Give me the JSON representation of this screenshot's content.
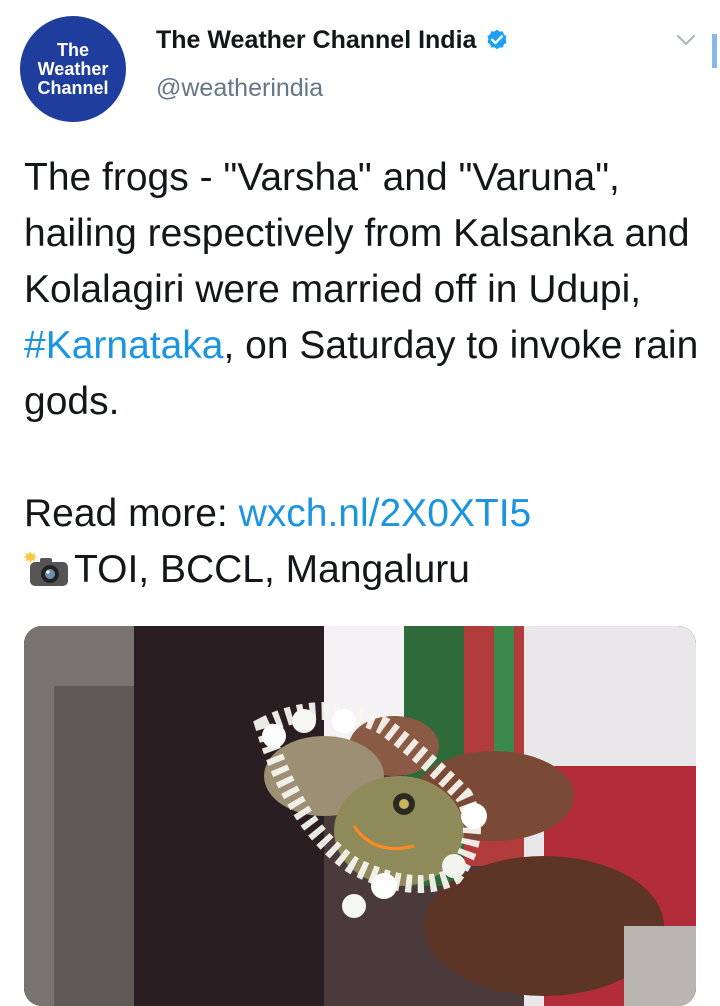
{
  "avatar": {
    "line1": "The",
    "line2": "Weather",
    "line3": "Channel"
  },
  "author": {
    "name": "The Weather Channel India",
    "handle": "@weatherindia"
  },
  "tweet": {
    "text_before": "The frogs - \"Varsha\" and \"Varuna\", hailing respectively from Kalsanka and Kolalagiri were married off in Udupi, ",
    "hashtag": "#Karnataka",
    "text_after": ", on Saturday to invoke rain gods.",
    "read_more_label": "Read more: ",
    "read_more_link": "wxch.nl/2X0XTI5",
    "credit": "TOI, BCCL, Mangaluru"
  },
  "icons": {
    "verified": "verified-badge-icon",
    "menu": "chevron-down-icon",
    "camera": "camera-flash-icon"
  },
  "colors": {
    "link": "#1b95e0",
    "avatar_bg": "#1f3d9c",
    "handle": "#657786"
  }
}
